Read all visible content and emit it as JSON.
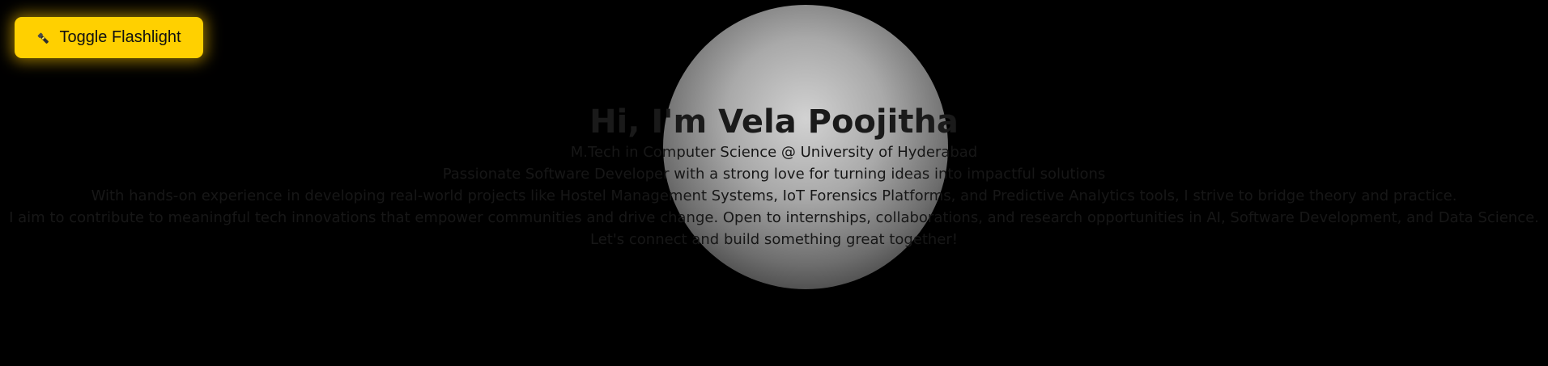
{
  "header": {
    "toggle_label": "Toggle Flashlight",
    "toggle_icon": "flashlight-icon"
  },
  "hero": {
    "title": "Hi, I'm Vela Poojitha",
    "lines": [
      "M.Tech in Computer Science @ University of Hyderabad",
      "Passionate Software Developer with a strong love for turning ideas into impactful solutions",
      "With hands-on experience in developing real-world projects like Hostel Management Systems, IoT Forensics Platforms, and Predictive Analytics tools, I strive to bridge theory and practice.",
      "I aim to contribute to meaningful tech innovations that empower communities and drive change. Open to internships, collaborations, and research opportunities in AI, Software Development, and Data Science.",
      "Let's connect and build something great together!"
    ]
  },
  "colors": {
    "background": "#000000",
    "button": "#ffd000",
    "button_glow": "#ffc400",
    "text": "#151515"
  }
}
